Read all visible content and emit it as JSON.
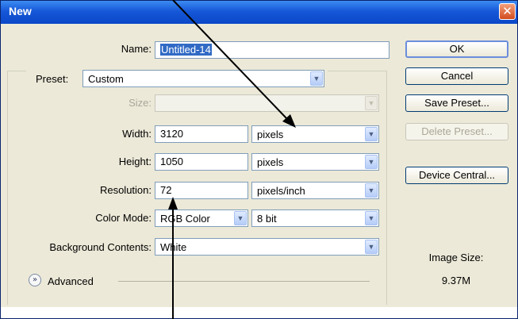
{
  "dialog": {
    "title": "New",
    "close_glyph": "✕"
  },
  "form": {
    "name_label": "Name:",
    "name_value": "Untitled-14",
    "preset_label": "Preset:",
    "preset_value": "Custom",
    "size_label": "Size:",
    "size_value": "",
    "width_label": "Width:",
    "width_value": "3120",
    "width_unit": "pixels",
    "height_label": "Height:",
    "height_value": "1050",
    "height_unit": "pixels",
    "resolution_label": "Resolution:",
    "resolution_value": "72",
    "resolution_unit": "pixels/inch",
    "color_mode_label": "Color Mode:",
    "color_mode_value": "RGB Color",
    "bit_depth_value": "8 bit",
    "background_label": "Background Contents:",
    "background_value": "White",
    "advanced_label": "Advanced",
    "dropdown_glyph": "▼",
    "advanced_glyph": "»"
  },
  "buttons": {
    "ok": "OK",
    "cancel": "Cancel",
    "save_preset": "Save Preset...",
    "delete_preset": "Delete Preset...",
    "device_central": "Device Central..."
  },
  "image_size": {
    "label": "Image Size:",
    "value": "9.37M"
  },
  "colors": {
    "titlebar": "#0a48c8",
    "dialog_bg": "#ece9d8",
    "selection": "#316ac5",
    "annotation_arrows": "#000000"
  }
}
